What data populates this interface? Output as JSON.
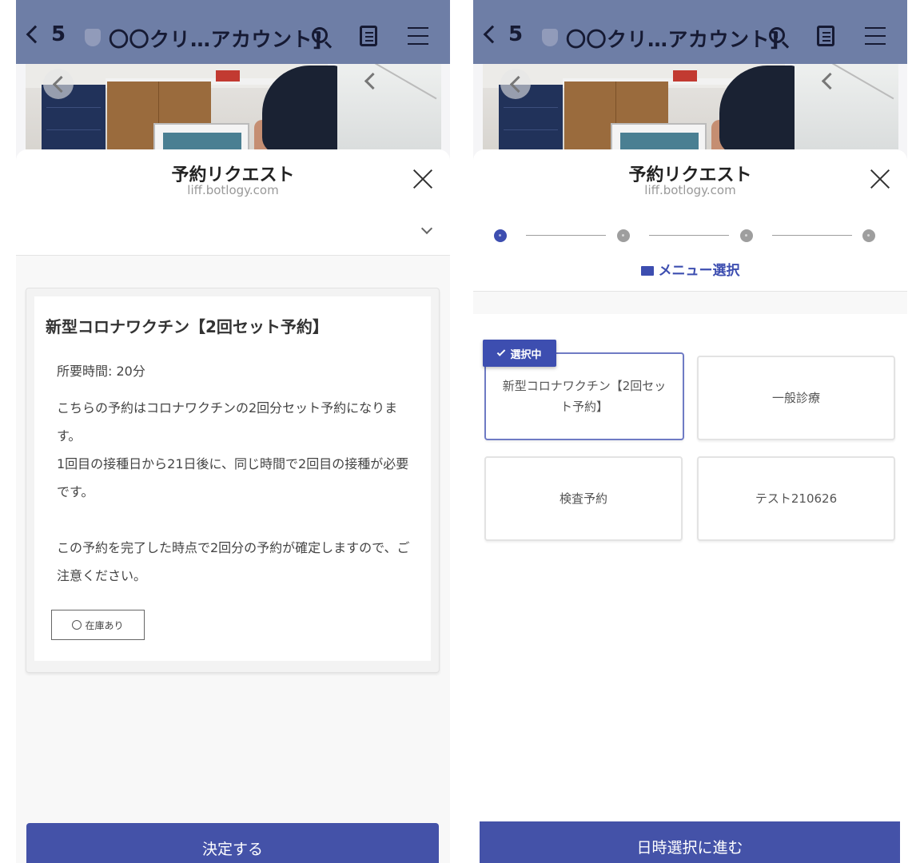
{
  "header": {
    "back_count": "5",
    "chat_title": "〇〇クリ…アカウント]"
  },
  "sheet": {
    "title": "予約リクエスト",
    "url": "liff.botlogy.com"
  },
  "left": {
    "card": {
      "title": "新型コロナワクチン【2回セット予約】",
      "duration": "所要時間: 20分",
      "description": "こちらの予約はコロナワクチンの2回分セット予約になります。\n1回目の接種日から21日後に、同じ時間で2回目の接種が必要です。\n\nこの予約を完了した時点で2回分の予約が確定しますので、ご注意ください。",
      "stock": "在庫あり"
    },
    "submit_label": "決定する"
  },
  "right": {
    "stepper": {
      "current_step_label": "メニュー選択",
      "steps_total": 4,
      "current_step": 1
    },
    "selected_badge": "選択中",
    "menu_items": [
      "新型コロナワクチン【2回セット予約】",
      "一般診療",
      "検査予約",
      "テスト210626"
    ],
    "next_label": "日時選択に進む"
  },
  "colors": {
    "accent": "#4452a8",
    "header_bg": "#6e7ea6",
    "step_active": "#3d4eb0",
    "step_inactive": "#9e9e9e"
  }
}
